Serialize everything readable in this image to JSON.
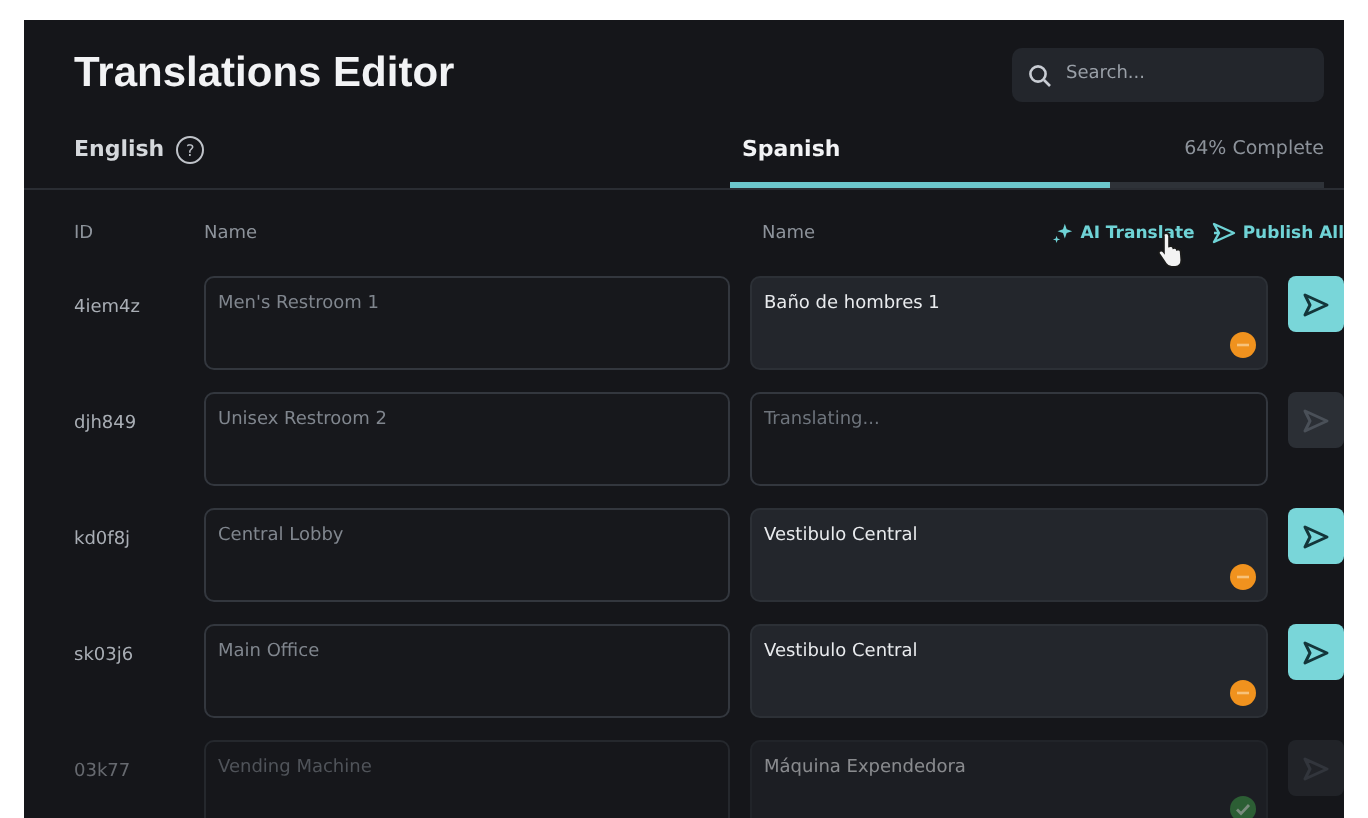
{
  "title": "Translations Editor",
  "search": {
    "placeholder": "Search..."
  },
  "source_language": {
    "label": "English",
    "help": "?"
  },
  "target_language": {
    "label": "Spanish",
    "selected": true,
    "level": 0.64,
    "progress_text": "64% Complete"
  },
  "columns": [
    "ID",
    "Name",
    "Name"
  ],
  "actions": [
    {
      "kind": "ai",
      "label": "AI Translate"
    },
    {
      "kind": "publish",
      "label": "Publish All"
    }
  ],
  "rows": [
    {
      "id": "4iem4z",
      "source": "Men's Restroom 1",
      "translation": "Baño de hombres 1",
      "kind": "draft",
      "publish_enabled": true,
      "faded": false
    },
    {
      "id": "djh849",
      "source": "Unisex Restroom 2",
      "placeholder": "Translating...",
      "kind": "translating",
      "publish_enabled": false,
      "faded": false
    },
    {
      "id": "kd0f8j",
      "source": "Central Lobby",
      "translation": "Vestibulo Central",
      "kind": "draft",
      "publish_enabled": true,
      "faded": false
    },
    {
      "id": "sk03j6",
      "source": "Main Office",
      "translation": "Vestibulo Central",
      "kind": "draft",
      "publish_enabled": true,
      "faded": false
    },
    {
      "id": "03k77",
      "source": "Vending Machine",
      "translation": "Máquina Expendedora",
      "kind": "published",
      "publish_enabled": false,
      "faded": true
    }
  ]
}
